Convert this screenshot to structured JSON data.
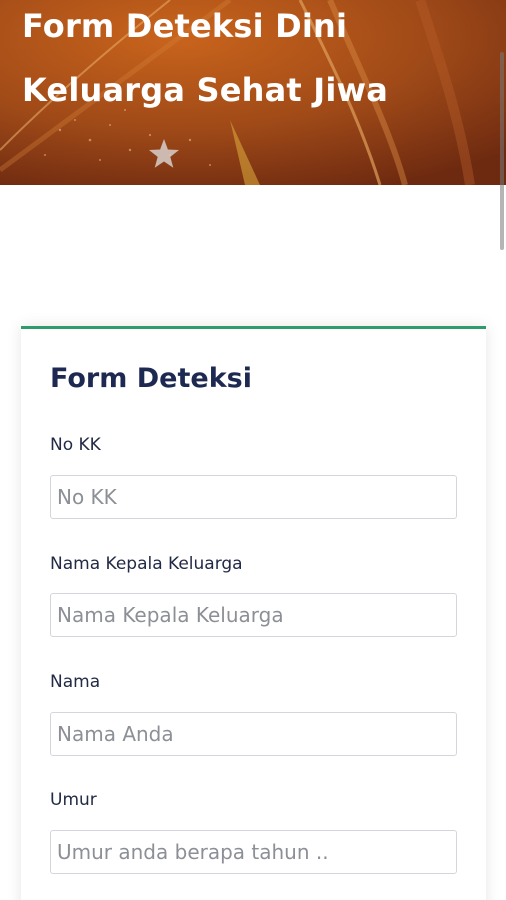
{
  "hero": {
    "title_line1": "Form Deteksi Dini",
    "title_line2": "Keluarga Sehat Jiwa"
  },
  "form": {
    "title": "Form Deteksi",
    "fields": [
      {
        "label": "No KK",
        "placeholder": "No KK",
        "value": ""
      },
      {
        "label": "Nama Kepala Keluarga",
        "placeholder": "Nama Kepala Keluarga",
        "value": ""
      },
      {
        "label": "Nama",
        "placeholder": "Nama Anda",
        "value": ""
      },
      {
        "label": "Umur",
        "placeholder": "Umur anda berapa tahun ..",
        "value": ""
      }
    ]
  },
  "colors": {
    "hero_bg": "#8a3c16",
    "card_accent": "#2f9a6c",
    "title_color": "#1d2951"
  },
  "icons": [
    "star-icon"
  ]
}
